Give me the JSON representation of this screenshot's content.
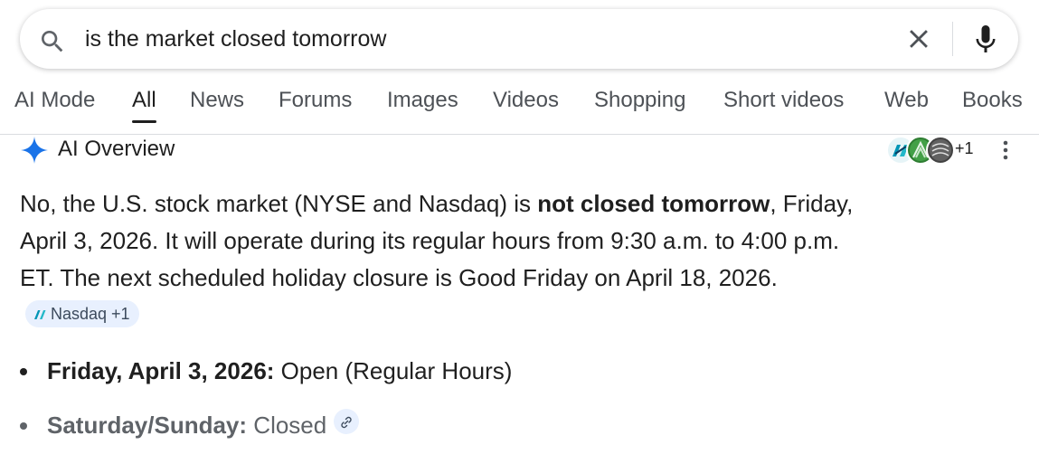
{
  "search": {
    "query": "is the market closed tomorrow"
  },
  "tabs": [
    {
      "label": "AI Mode"
    },
    {
      "label": "All"
    },
    {
      "label": "News"
    },
    {
      "label": "Forums"
    },
    {
      "label": "Images"
    },
    {
      "label": "Videos"
    },
    {
      "label": "Shopping"
    },
    {
      "label": "Short videos"
    },
    {
      "label": "Web"
    },
    {
      "label": "Books"
    }
  ],
  "ai_overview": {
    "title": "AI Overview",
    "source_count": "+1",
    "summary_p1": "No, the U.S. stock market (NYSE and Nasdaq) is ",
    "summary_bold": "not closed tomorrow",
    "summary_p2": ", Friday, April 3, 2026. It will operate during its regular hours from 9:30 a.m. to 4:00 p.m. ET. The next scheduled holiday closure is Good Friday on April 18, 2026.",
    "source_chip": "Nasdaq +1",
    "bullets": [
      {
        "label": "Friday, April 3, 2026:",
        "text": " Open (Regular Hours)"
      },
      {
        "label": "Saturday/Sunday:",
        "text": " Closed"
      }
    ]
  },
  "colors": {
    "accent_blue": "#1a73e8",
    "chip_bg": "#e8f0fe",
    "text": "#1f1f1f",
    "muted": "#4d5156"
  }
}
